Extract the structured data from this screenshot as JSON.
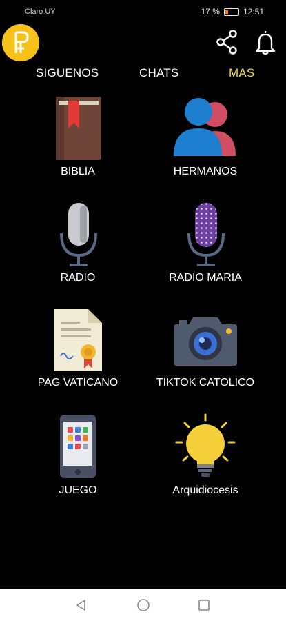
{
  "status_bar": {
    "carrier": "Claro UY",
    "battery": "17 %",
    "time": "12:51"
  },
  "tabs": [
    {
      "label": "SIGUENOS",
      "active": false
    },
    {
      "label": "CHATS",
      "active": false
    },
    {
      "label": "MAS",
      "active": true
    }
  ],
  "grid": [
    {
      "label": "BIBLIA",
      "icon": "bible-icon"
    },
    {
      "label": "HERMANOS",
      "icon": "people-icon"
    },
    {
      "label": "RADIO",
      "icon": "microphone-icon"
    },
    {
      "label": "RADIO MARIA",
      "icon": "purple-microphone-icon"
    },
    {
      "label": "PAG VATICANO",
      "icon": "certificate-icon"
    },
    {
      "label": "TIKTOK CATOLICO",
      "icon": "camera-icon"
    },
    {
      "label": "JUEGO",
      "icon": "smartphone-icon"
    },
    {
      "label": "Arquidiocesis",
      "icon": "lightbulb-icon"
    }
  ],
  "colors": {
    "accent": "#f2e23b",
    "background": "#000000",
    "logo": "#f6c21a"
  }
}
